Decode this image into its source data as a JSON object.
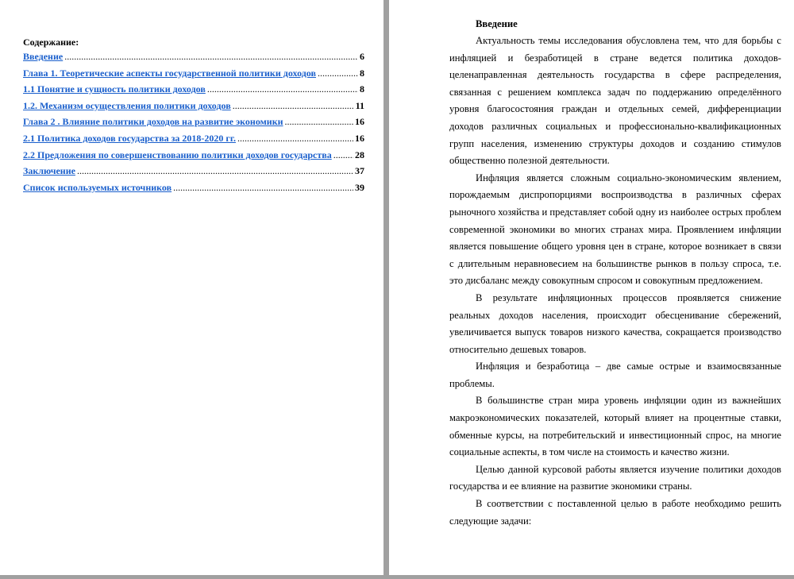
{
  "toc": {
    "title": "Содержание:",
    "entries": [
      {
        "label": "Введение",
        "page": "6"
      },
      {
        "label": "Глава 1. Теоретические аспекты государственной политики доходов",
        "page": "8"
      },
      {
        "label": "1.1 Понятие и сущность политики доходов",
        "page": "8"
      },
      {
        "label": "1.2. Механизм осуществления политики доходов",
        "page": "11"
      },
      {
        "label": "Глава 2 . Влияние политики доходов на развитие экономики",
        "page": "16"
      },
      {
        "label": "2.1 Политика доходов государства за 2018-2020 гг.",
        "page": "16"
      },
      {
        "label": "2.2 Предложения по совершенствованию политики доходов государства",
        "page": "28"
      },
      {
        "label": "Заключение",
        "page": "37"
      },
      {
        "label": "Список используемых источников",
        "page": "39"
      }
    ]
  },
  "intro": {
    "heading": "Введение",
    "paragraphs": [
      "Актуальность темы исследования обусловлена тем, что для борьбы с инфляцией и безработицей в стране ведется политика доходов-целенаправленная деятельность государства в сфере распределения, связанная с решением комплекса задач по поддержанию определённого уровня благосостояния граждан и отдельных семей, дифференциации доходов различных социальных и профессионально-квалификационных групп населения, изменению структуры доходов и созданию стимулов общественно полезной деятельности.",
      "Инфляция является сложным социально-экономическим явлением, порождаемым диспропорциями воспроизводства в различных сферах рыночного хозяйства и представляет собой одну из наиболее острых проблем современной экономики во многих странах мира. Проявлением инфляции является повышение общего уровня цен в стране, которое возникает в связи с длительным неравновесием на большинстве рынков в пользу спроса, т.е. это дисбаланс между совокупным спросом и совокупным предложением.",
      "В результате инфляционных процессов проявляется снижение реальных доходов населения, происходит обесценивание сбережений, увеличивается выпуск товаров низкого качества, сокращается производство относительно дешевых товаров.",
      "Инфляция и безработица – две самые острые и взаимосвязанные проблемы.",
      "В большинстве стран мира уровень инфляции один из важнейших макроэкономических показателей, который влияет на процентные ставки, обменные курсы, на потребительский и инвестиционный спрос, на многие социальные аспекты, в том числе на стоимость и качество жизни.",
      "Целью данной курсовой работы является изучение политики доходов государства и ее влияние на развитие экономики страны.",
      "В соответствии с поставленной целью в работе необходимо решить следующие задачи:"
    ]
  }
}
